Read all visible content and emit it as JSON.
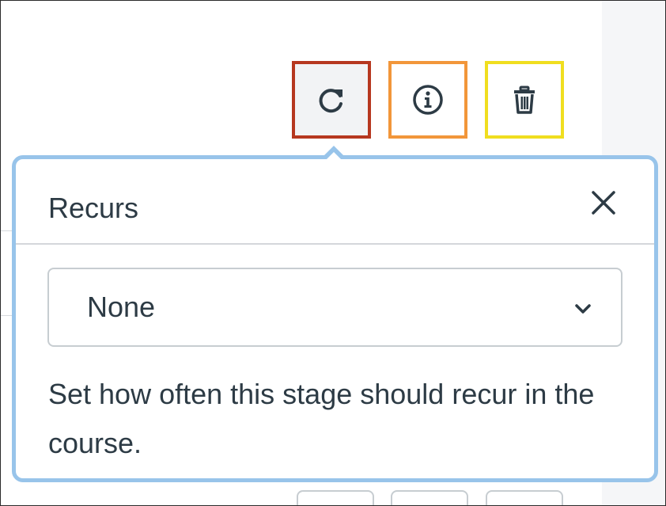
{
  "toolbar": {
    "buttons": [
      {
        "name": "recurrence-button",
        "icon": "refresh-icon",
        "border_color": "#b6371f"
      },
      {
        "name": "info-button",
        "icon": "info-icon",
        "border_color": "#f2963a"
      },
      {
        "name": "delete-button",
        "icon": "trash-icon",
        "border_color": "#f0de1f"
      }
    ]
  },
  "popover": {
    "title": "Recurs",
    "close_icon": "close-icon",
    "border_color": "#98c4ea",
    "select": {
      "value": "None",
      "icon": "chevron-down-icon"
    },
    "help_text": "Set how often this stage should recur in the course."
  }
}
